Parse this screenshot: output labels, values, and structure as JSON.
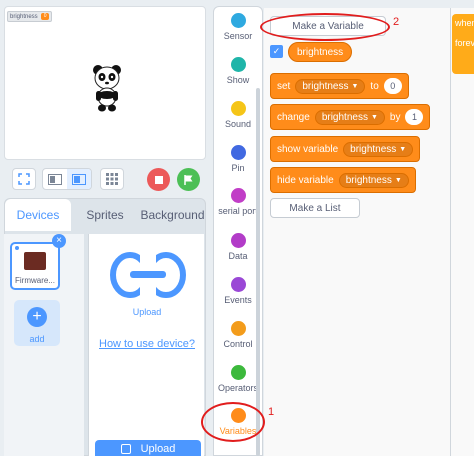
{
  "stage": {
    "monitor_label": "brightness",
    "monitor_value": "0"
  },
  "tabs": [
    "Devices",
    "Sprites",
    "Background"
  ],
  "device": {
    "name": "Firmware...",
    "add_label": "add",
    "upload_label": "Upload",
    "how_to_link": "How to use device?",
    "upload_button": "Upload"
  },
  "categories": [
    {
      "label": "Sensor",
      "color": "#2ea9e0"
    },
    {
      "label": "Show",
      "color": "#1fb5a9"
    },
    {
      "label": "Sound",
      "color": "#f5c518"
    },
    {
      "label": "Pin",
      "color": "#4169e1"
    },
    {
      "label": "serial port",
      "color": "#c13ec7"
    },
    {
      "label": "Data",
      "color": "#b23cc8"
    },
    {
      "label": "Events",
      "color": "#9a48d6"
    },
    {
      "label": "Control",
      "color": "#f39c1b"
    },
    {
      "label": "Operators",
      "color": "#3cb93c"
    },
    {
      "label": "Variables",
      "color": "#ff8c1a"
    }
  ],
  "palette": {
    "make_variable": "Make a Variable",
    "variable_name": "brightness",
    "set_block": {
      "verb": "set",
      "var": "brightness",
      "to": "to",
      "value": "0"
    },
    "change_block": {
      "verb": "change",
      "var": "brightness",
      "by": "by",
      "value": "1"
    },
    "show_block": {
      "verb": "show variable",
      "var": "brightness"
    },
    "hide_block": {
      "verb": "hide variable",
      "var": "brightness"
    },
    "make_list": "Make a List"
  },
  "script": {
    "block1": "when",
    "block2": "forever"
  },
  "annotations": {
    "one": "1",
    "two": "2"
  },
  "colors": {
    "accent": "#4c97ff",
    "variables": "#ff8c1a",
    "annotation": "#e11d1d"
  }
}
